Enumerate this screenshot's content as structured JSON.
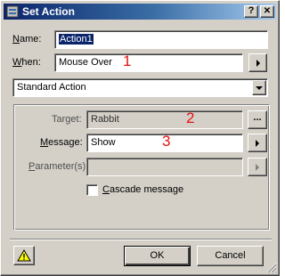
{
  "window": {
    "title": "Set Action",
    "help_label": "?",
    "close_label": "✕"
  },
  "form": {
    "name_label": "Name:",
    "name_value": "Action1",
    "when_label": "When:",
    "when_value": "Mouse Over",
    "when_annotation": "1",
    "action_type_value": "Standard Action",
    "target_label": "Target:",
    "target_value": "Rabbit",
    "target_annotation": "2",
    "browse_label": "...",
    "message_label": "Message:",
    "message_value": "Show",
    "message_annotation": "3",
    "parameters_label": "Parameter(s):",
    "parameters_value": "",
    "cascade_label": "Cascade message",
    "cascade_checked": false
  },
  "footer": {
    "ok_label": "OK",
    "cancel_label": "Cancel",
    "warning_icon": "warning-icon"
  }
}
